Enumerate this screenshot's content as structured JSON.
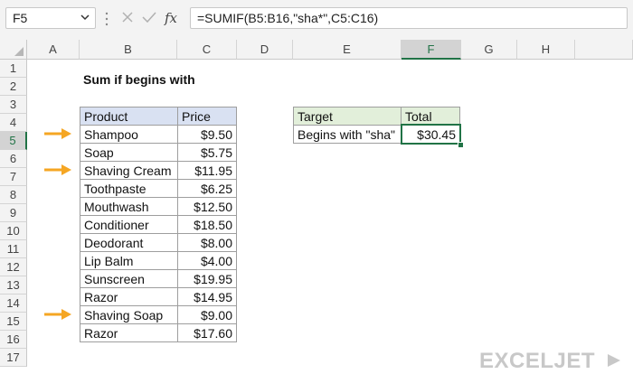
{
  "formula_bar": {
    "name_box": "F5",
    "formula": "=SUMIF(B5:B16,\"sha*\",C5:C16)",
    "icons": [
      "cancel-icon",
      "enter-icon",
      "function-icon"
    ]
  },
  "columns": [
    "A",
    "B",
    "C",
    "D",
    "E",
    "F",
    "G",
    "H"
  ],
  "active_column": "F",
  "rows": [
    "1",
    "2",
    "3",
    "4",
    "5",
    "6",
    "7",
    "8",
    "9",
    "10",
    "11",
    "12",
    "13",
    "14",
    "15",
    "16",
    "17"
  ],
  "active_row": "5",
  "sheet": {
    "title": "Sum if begins with",
    "product_table": {
      "headers": {
        "product": "Product",
        "price": "Price"
      },
      "rows": [
        {
          "product": "Shampoo",
          "price": "$9.50",
          "arrow": true
        },
        {
          "product": "Soap",
          "price": "$5.75",
          "arrow": false
        },
        {
          "product": "Shaving Cream",
          "price": "$11.95",
          "arrow": true
        },
        {
          "product": "Toothpaste",
          "price": "$6.25",
          "arrow": false
        },
        {
          "product": "Mouthwash",
          "price": "$12.50",
          "arrow": false
        },
        {
          "product": "Conditioner",
          "price": "$18.50",
          "arrow": false
        },
        {
          "product": "Deodorant",
          "price": "$8.00",
          "arrow": false
        },
        {
          "product": "Lip Balm",
          "price": "$4.00",
          "arrow": false
        },
        {
          "product": "Sunscreen",
          "price": "$19.95",
          "arrow": false
        },
        {
          "product": "Razor",
          "price": "$14.95",
          "arrow": false
        },
        {
          "product": "Shaving Soap",
          "price": "$9.00",
          "arrow": true
        },
        {
          "product": "Razor",
          "price": "$17.60",
          "arrow": false
        }
      ]
    },
    "summary_table": {
      "headers": {
        "target": "Target",
        "total": "Total"
      },
      "target": "Begins with \"sha\"",
      "total": "$30.45"
    }
  },
  "branding": {
    "logo_text": "EXCELJET"
  },
  "colors": {
    "accent_green": "#217346",
    "arrow_orange": "#f5a623",
    "header_blue": "#d9e1f2",
    "header_green": "#e2efda"
  }
}
